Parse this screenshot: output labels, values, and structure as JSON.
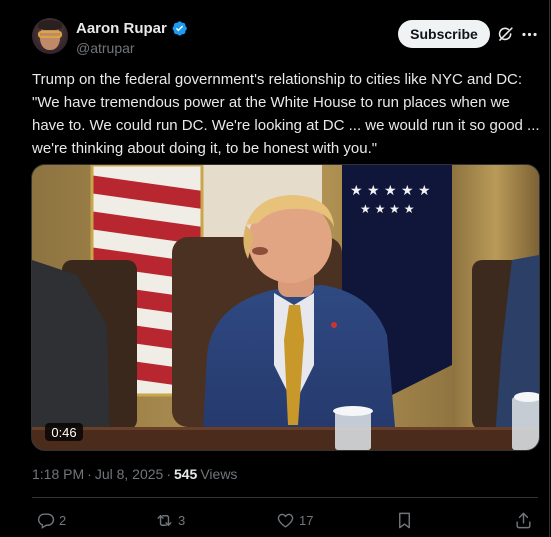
{
  "tweet": {
    "author": {
      "name": "Aaron Rupar",
      "handle": "@atrupar",
      "verified": true
    },
    "subscribe_label": "Subscribe",
    "text": "Trump on the federal government's relationship to cities like NYC and DC: \"We have tremendous power at the White House to run places when we have to. We could run DC. We're looking at DC ... we would run it so good ... we're thinking about doing it, to be honest with you.\"",
    "video": {
      "duration": "0:46"
    },
    "meta": {
      "time": "1:18 PM",
      "separator": "·",
      "date": "Jul 8, 2025",
      "views_count": "545",
      "views_label": "Views"
    },
    "actions": {
      "replies": "2",
      "reposts": "3",
      "likes": "17"
    }
  },
  "colors": {
    "background": "#000000",
    "text": "#e7e9ea",
    "secondary_text": "#71767b",
    "verified_blue": "#1d9bf0",
    "divider": "#2f3336"
  },
  "icons": [
    "verified-badge-icon",
    "grok-icon",
    "more-icon",
    "reply-icon",
    "repost-icon",
    "like-icon",
    "bookmark-icon",
    "share-icon"
  ]
}
